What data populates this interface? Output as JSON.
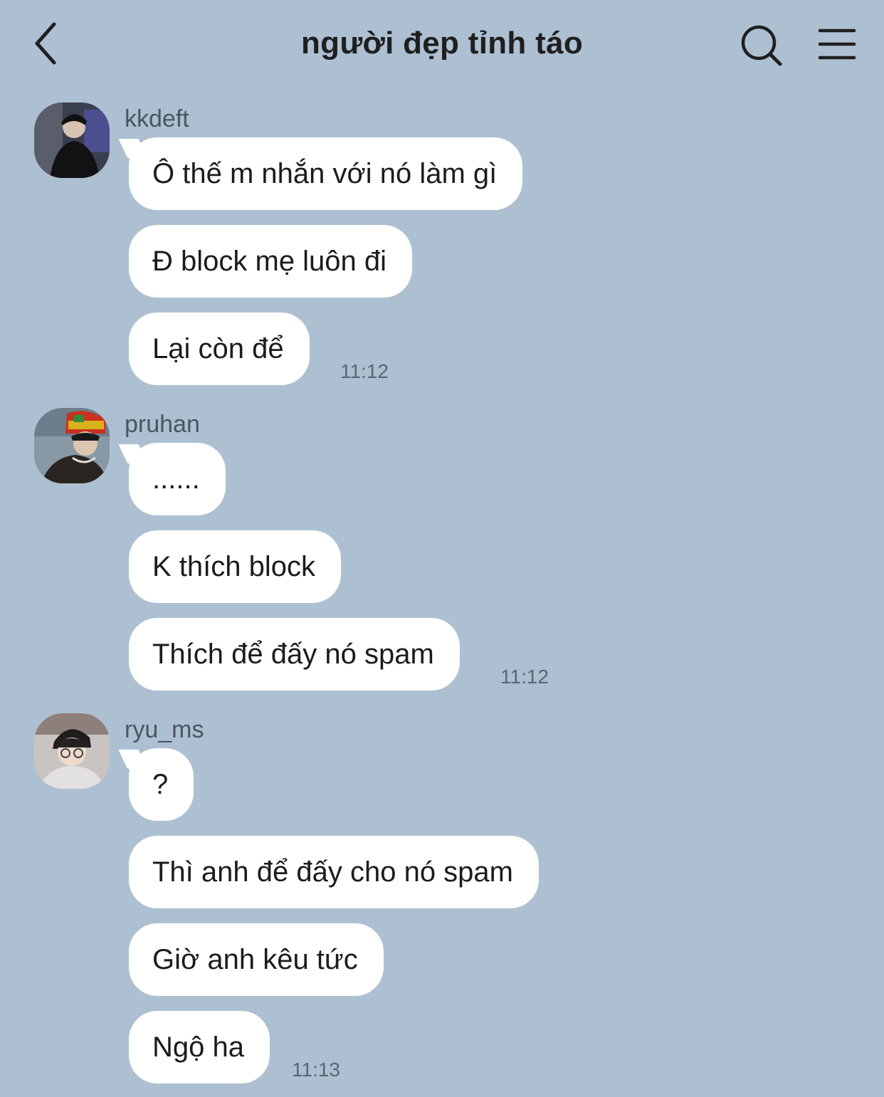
{
  "header": {
    "title": "người đẹp tỉnh táo"
  },
  "groups": [
    {
      "sender": "kkdeft",
      "messages": [
        "Ô thế m nhắn với nó làm gì",
        "Đ block mẹ luôn đi",
        "Lại còn để"
      ],
      "time": "11:12"
    },
    {
      "sender": "pruhan",
      "messages": [
        "......",
        "K thích block",
        "Thích để đấy nó spam"
      ],
      "time": "11:12"
    },
    {
      "sender": "ryu_ms",
      "messages": [
        "?",
        "Thì anh để đấy cho nó spam",
        "Giờ anh kêu tức",
        "Ngộ ha"
      ],
      "time": "11:13"
    }
  ],
  "icons": {
    "back": "chevron-left-icon",
    "search": "search-icon",
    "menu": "menu-icon"
  },
  "colors": {
    "background": "#adc0d2",
    "bubble": "#ffffff"
  }
}
